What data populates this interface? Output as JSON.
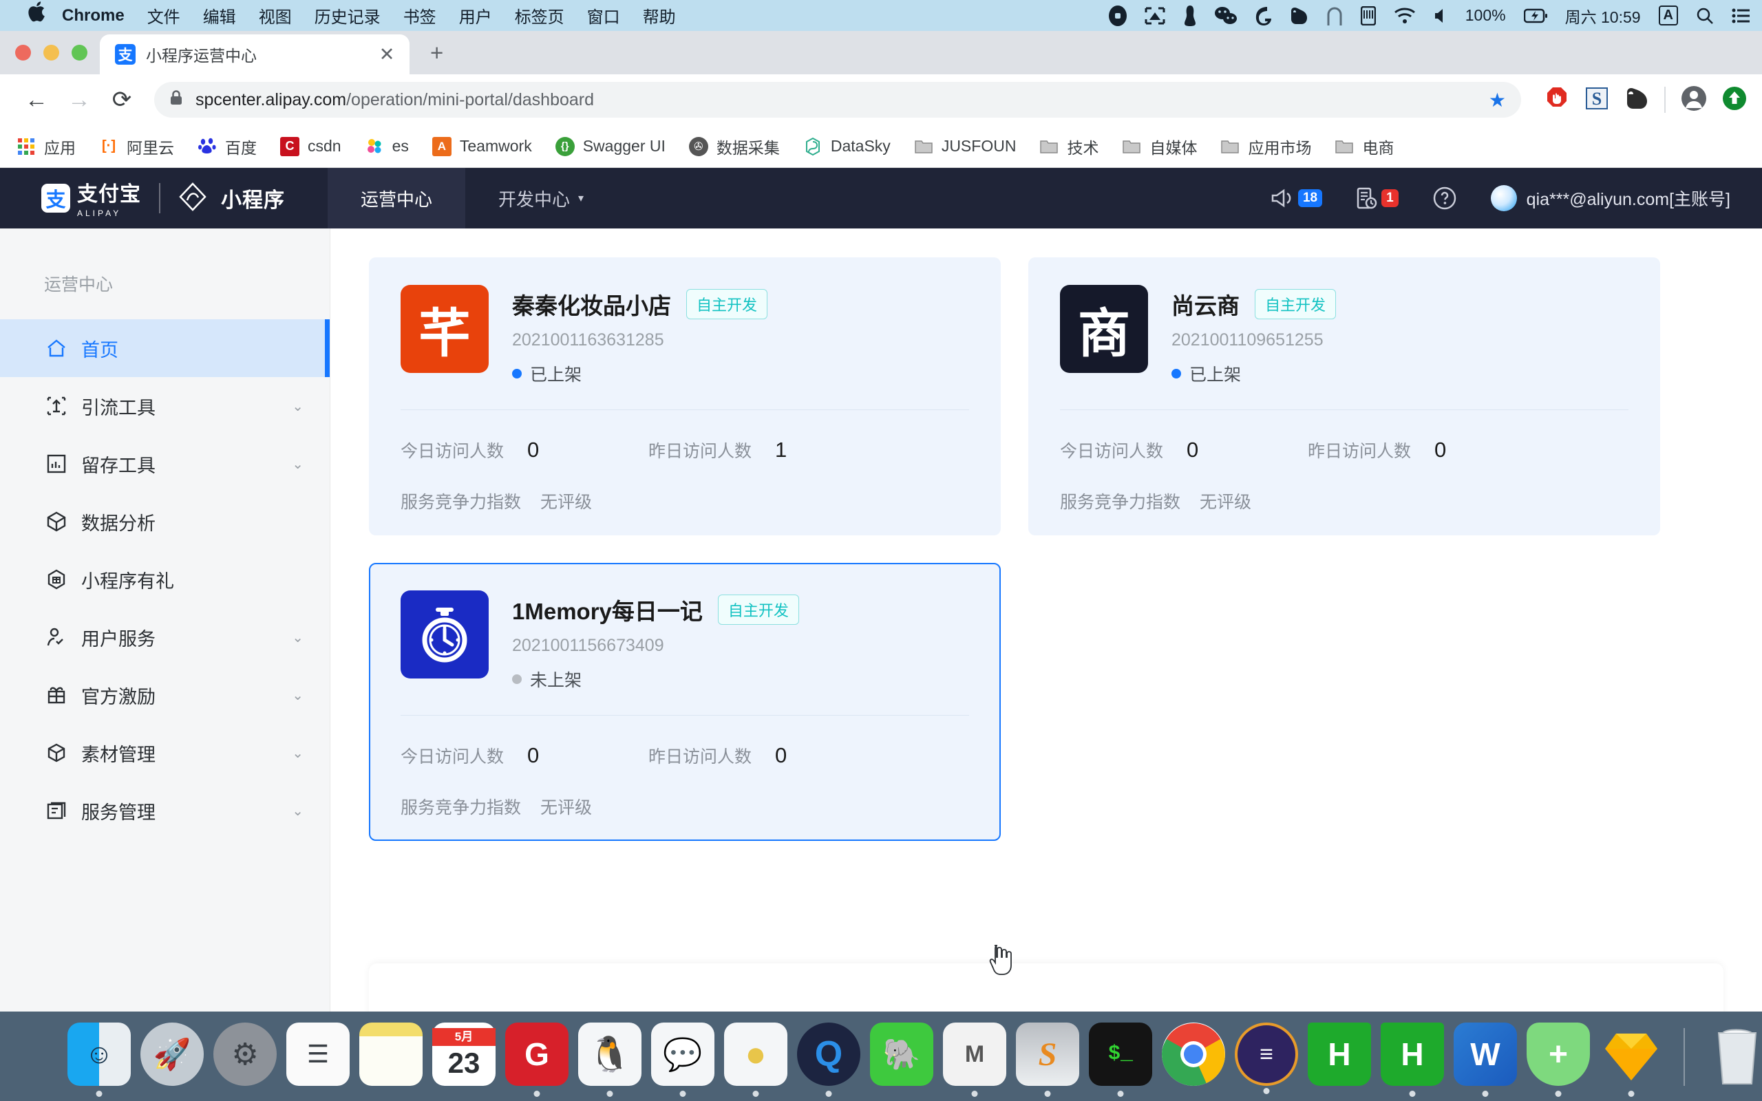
{
  "menubar": {
    "apple": "",
    "items": [
      {
        "label": "Chrome",
        "bold": true
      },
      {
        "label": "文件",
        "bold": false
      },
      {
        "label": "编辑",
        "bold": false
      },
      {
        "label": "视图",
        "bold": false
      },
      {
        "label": "历史记录",
        "bold": false
      },
      {
        "label": "书签",
        "bold": false
      },
      {
        "label": "用户",
        "bold": false
      },
      {
        "label": "标签页",
        "bold": false
      },
      {
        "label": "窗口",
        "bold": false
      },
      {
        "label": "帮助",
        "bold": false
      }
    ],
    "status": {
      "battery_percent": "100%",
      "clock": "周六 10:59",
      "input_source": "A"
    }
  },
  "browser": {
    "tab": {
      "title": "小程序运营中心",
      "favicon_label": "支",
      "close_label": "✕"
    },
    "newtab_label": "+",
    "nav": {
      "back": "←",
      "forward": "→",
      "reload": "⟳"
    },
    "omnibox": {
      "url_main": "spcenter.alipay.com",
      "url_path": "/operation/mini-portal/dashboard",
      "lock_icon": "lock-icon"
    },
    "bookmarks": [
      {
        "label": "应用",
        "icon": "apps-grid-icon",
        "color": "#4285f4",
        "glyph": "⠿"
      },
      {
        "label": "阿里云",
        "icon": "aliyun-icon",
        "color": "#ff6a00",
        "glyph": "[·]"
      },
      {
        "label": "百度",
        "icon": "baidu-icon",
        "color": "#2932e1",
        "glyph": "熊"
      },
      {
        "label": "csdn",
        "icon": "csdn-icon",
        "color": "#c8111e",
        "glyph": "C"
      },
      {
        "label": "es",
        "icon": "elastic-icon",
        "color": "#f0b429",
        "glyph": "✿"
      },
      {
        "label": "Teamwork",
        "icon": "teamwork-icon",
        "color": "#ec6c1b",
        "glyph": "A"
      },
      {
        "label": "Swagger UI",
        "icon": "swagger-icon",
        "color": "#3aa03a",
        "glyph": "{·}"
      },
      {
        "label": "数据采集",
        "icon": "globe-icon",
        "color": "#5f6368",
        "glyph": "✇"
      },
      {
        "label": "DataSky",
        "icon": "datasky-icon",
        "color": "#2fae8e",
        "glyph": "S"
      },
      {
        "label": "JUSFOUN",
        "icon": "folder-icon",
        "color": "#b9b9b9",
        "glyph": "▤"
      },
      {
        "label": "技术",
        "icon": "folder-icon",
        "color": "#b9b9b9",
        "glyph": "▤"
      },
      {
        "label": "自媒体",
        "icon": "folder-icon",
        "color": "#b9b9b9",
        "glyph": "▤"
      },
      {
        "label": "应用市场",
        "icon": "folder-icon",
        "color": "#b9b9b9",
        "glyph": "▤"
      },
      {
        "label": "电商",
        "icon": "folder-icon",
        "color": "#b9b9b9",
        "glyph": "▤"
      }
    ]
  },
  "app_header": {
    "logo_text": "支付宝",
    "logo_sub": "ALIPAY",
    "logo_mark": "支",
    "product_name": "小程序",
    "tabs": [
      {
        "label": "运营中心",
        "active": true,
        "has_caret": false
      },
      {
        "label": "开发中心",
        "active": false,
        "has_caret": true
      }
    ],
    "caret": "▾",
    "notifications": {
      "megaphone_count": "18",
      "doc_count": "1",
      "help_label": "?"
    },
    "account": "qia***@aliyun.com[主账号]"
  },
  "sidebar": {
    "title": "运营中心",
    "items": [
      {
        "label": "首页",
        "icon": "home-icon",
        "active": true,
        "expandable": false
      },
      {
        "label": "引流工具",
        "icon": "traffic-tool-icon",
        "active": false,
        "expandable": true
      },
      {
        "label": "留存工具",
        "icon": "retention-chart-icon",
        "active": false,
        "expandable": true
      },
      {
        "label": "数据分析",
        "icon": "cube-analytics-icon",
        "active": false,
        "expandable": false
      },
      {
        "label": "小程序有礼",
        "icon": "gift-hex-icon",
        "active": false,
        "expandable": false
      },
      {
        "label": "用户服务",
        "icon": "user-check-icon",
        "active": false,
        "expandable": true
      },
      {
        "label": "官方激励",
        "icon": "gift-box-icon",
        "active": false,
        "expandable": true
      },
      {
        "label": "素材管理",
        "icon": "package-icon",
        "active": false,
        "expandable": true
      },
      {
        "label": "服务管理",
        "icon": "service-list-icon",
        "active": false,
        "expandable": true
      }
    ],
    "caret": "⌄"
  },
  "cards": {
    "labels": {
      "today_visitors": "今日访问人数",
      "yesterday_visitors": "昨日访问人数",
      "rating_label": "服务竞争力指数"
    },
    "items": [
      {
        "name": "秦秦化妆品小店",
        "tag": "自主开发",
        "app_id": "2021001163631285",
        "status": "已上架",
        "status_online": true,
        "icon_glyph": "芊",
        "icon_bg": "#e8420c",
        "today": "0",
        "yesterday": "1",
        "rating": "无评级",
        "selected": false
      },
      {
        "name": "尚云商",
        "tag": "自主开发",
        "app_id": "2021001109651255",
        "status": "已上架",
        "status_online": true,
        "icon_glyph": "商",
        "icon_bg": "#15192a",
        "today": "0",
        "yesterday": "0",
        "rating": "无评级",
        "selected": false
      },
      {
        "name": "1Memory每日一记",
        "tag": "自主开发",
        "app_id": "2021001156673409",
        "status": "未上架",
        "status_online": false,
        "icon_glyph": "⏱",
        "icon_bg": "#1a2bc4",
        "today": "0",
        "yesterday": "0",
        "rating": "无评级",
        "selected": true
      }
    ]
  },
  "dock": {
    "items": [
      {
        "name": "finder-icon",
        "glyph": "☺",
        "color": "#1a9bf0",
        "running": true
      },
      {
        "name": "launchpad-icon",
        "glyph": "🚀",
        "color": "#b9c0c7",
        "running": false
      },
      {
        "name": "system-preferences-icon",
        "glyph": "⚙",
        "color": "#8a8f95",
        "running": false
      },
      {
        "name": "reminders-icon",
        "glyph": "☰",
        "color": "#f5f5f5",
        "running": false
      },
      {
        "name": "notes-icon",
        "glyph": "▤",
        "color": "#f6e9a8",
        "running": false
      },
      {
        "name": "calendar-icon",
        "glyph": "23",
        "color": "#ffffff",
        "running": false
      },
      {
        "name": "gitee-icon",
        "glyph": "G",
        "color": "#d7202a",
        "running": true
      },
      {
        "name": "qq-icon",
        "glyph": "🐧",
        "color": "#1a1a1a",
        "running": true
      },
      {
        "name": "wechat-icon",
        "glyph": "💬",
        "color": "#3ec93e",
        "running": true
      },
      {
        "name": "yellow-app-icon",
        "glyph": "◕",
        "color": "#e8c54a",
        "running": true
      },
      {
        "name": "quicktime-icon",
        "glyph": "Q",
        "color": "#1c2440",
        "running": true
      },
      {
        "name": "evernote-icon",
        "glyph": "🐘",
        "color": "#3ec93e",
        "running": false
      },
      {
        "name": "mindnode-icon",
        "glyph": "M",
        "color": "#f2f2f2",
        "running": true
      },
      {
        "name": "sublime-icon",
        "glyph": "S",
        "color": "#c8c8c8",
        "running": true
      },
      {
        "name": "terminal-icon",
        "glyph": "$_",
        "color": "#1a1a1a",
        "running": true
      },
      {
        "name": "chrome-icon",
        "glyph": "◉",
        "color": "#ffffff",
        "running": true
      },
      {
        "name": "purple-app-icon",
        "glyph": "≡",
        "color": "#2e2360",
        "running": true
      },
      {
        "name": "hbuilder-icon",
        "glyph": "H",
        "color": "#1eaa2c",
        "running": false
      },
      {
        "name": "hbuilderx-icon",
        "glyph": "H",
        "color": "#1eaa2c",
        "running": true
      },
      {
        "name": "word-icon",
        "glyph": "W",
        "color": "#1b5bbd",
        "running": true
      },
      {
        "name": "security-shield-icon",
        "glyph": "✛",
        "color": "#7ed97e",
        "running": true
      },
      {
        "name": "sketch-icon",
        "glyph": "◆",
        "color": "#f7b500",
        "running": true
      },
      {
        "name": "trash-icon",
        "glyph": "🗑",
        "color": "#d8dee3",
        "running": false
      }
    ]
  }
}
